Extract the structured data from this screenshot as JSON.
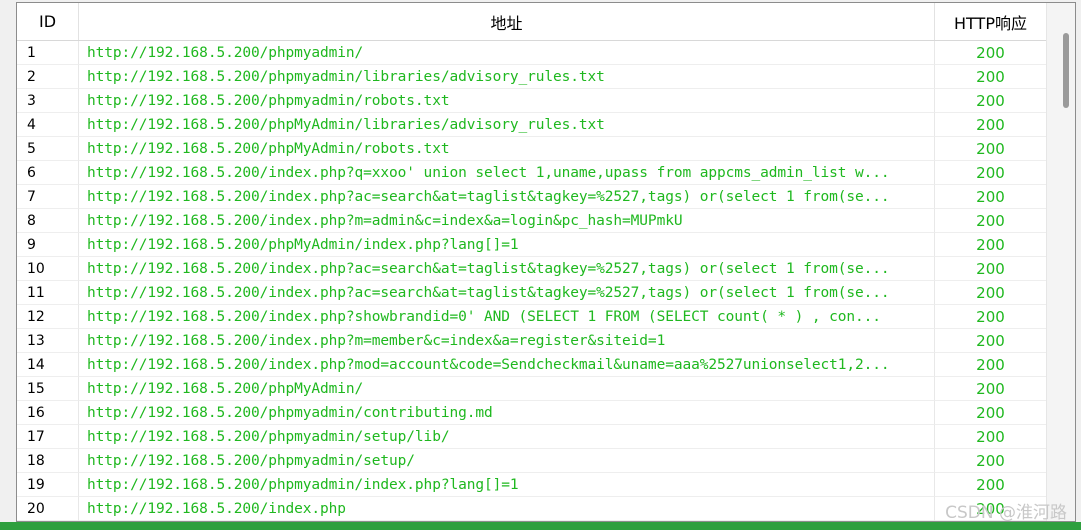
{
  "table": {
    "headers": {
      "id": "ID",
      "url": "地址",
      "http": "HTTP响应"
    },
    "rows": [
      {
        "id": "1",
        "url": "http://192.168.5.200/phpmyadmin/",
        "status": "200"
      },
      {
        "id": "2",
        "url": "http://192.168.5.200/phpmyadmin/libraries/advisory_rules.txt",
        "status": "200"
      },
      {
        "id": "3",
        "url": "http://192.168.5.200/phpmyadmin/robots.txt",
        "status": "200"
      },
      {
        "id": "4",
        "url": "http://192.168.5.200/phpMyAdmin/libraries/advisory_rules.txt",
        "status": "200"
      },
      {
        "id": "5",
        "url": "http://192.168.5.200/phpMyAdmin/robots.txt",
        "status": "200"
      },
      {
        "id": "6",
        "url": "http://192.168.5.200/index.php?q=xxoo' union select 1,uname,upass from appcms_admin_list w...",
        "status": "200"
      },
      {
        "id": "7",
        "url": "http://192.168.5.200/index.php?ac=search&at=taglist&tagkey=%2527,tags) or(select 1 from(se...",
        "status": "200"
      },
      {
        "id": "8",
        "url": "http://192.168.5.200/index.php?m=admin&c=index&a=login&pc_hash=MUPmkU",
        "status": "200"
      },
      {
        "id": "9",
        "url": "http://192.168.5.200/phpMyAdmin/index.php?lang[]=1",
        "status": "200"
      },
      {
        "id": "10",
        "url": "http://192.168.5.200/index.php?ac=search&at=taglist&tagkey=%2527,tags) or(select 1 from(se...",
        "status": "200"
      },
      {
        "id": "11",
        "url": "http://192.168.5.200/index.php?ac=search&at=taglist&tagkey=%2527,tags) or(select 1 from(se...",
        "status": "200"
      },
      {
        "id": "12",
        "url": "http://192.168.5.200/index.php?showbrandid=0' AND (SELECT 1 FROM (SELECT count( * ) , con...",
        "status": "200"
      },
      {
        "id": "13",
        "url": "http://192.168.5.200/index.php?m=member&c=index&a=register&siteid=1",
        "status": "200"
      },
      {
        "id": "14",
        "url": "http://192.168.5.200/index.php?mod=account&code=Sendcheckmail&uname=aaa%2527unionselect1,2...",
        "status": "200"
      },
      {
        "id": "15",
        "url": "http://192.168.5.200/phpMyAdmin/",
        "status": "200"
      },
      {
        "id": "16",
        "url": "http://192.168.5.200/phpmyadmin/contributing.md",
        "status": "200"
      },
      {
        "id": "17",
        "url": "http://192.168.5.200/phpmyadmin/setup/lib/",
        "status": "200"
      },
      {
        "id": "18",
        "url": "http://192.168.5.200/phpmyadmin/setup/",
        "status": "200"
      },
      {
        "id": "19",
        "url": "http://192.168.5.200/phpmyadmin/index.php?lang[]=1",
        "status": "200"
      },
      {
        "id": "20",
        "url": "http://192.168.5.200/index.php",
        "status": "200"
      }
    ]
  },
  "watermark": "CSDN @淮河路"
}
